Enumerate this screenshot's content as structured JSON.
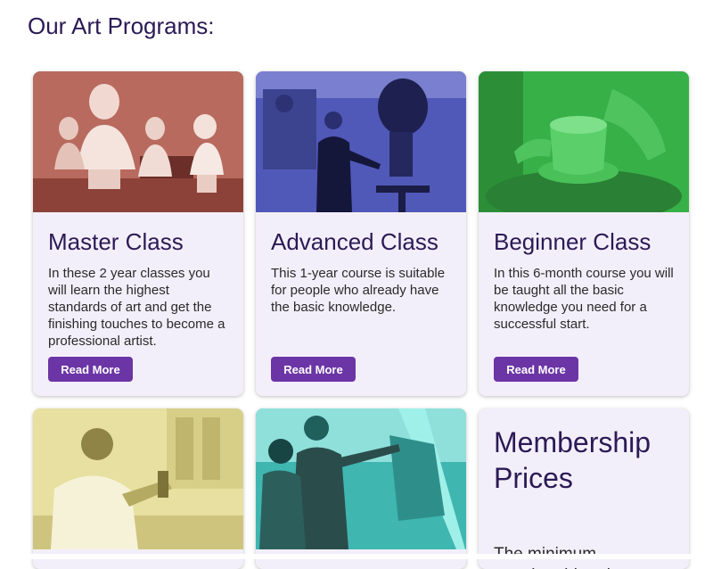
{
  "page": {
    "heading": "Our Art Programs:"
  },
  "cards": [
    {
      "title": "Master Class",
      "text": "In these 2 year classes you will learn the highest standards of art and get the finishing touches to become a professional artist.",
      "button": "Read More"
    },
    {
      "title": "Advanced Class",
      "text": "This 1-year course is suitable for people who already have the basic knowledge.",
      "button": "Read More"
    },
    {
      "title": "Beginner Class",
      "text": "In this 6-month course you will be taught all the basic knowledge you need for a successful start.",
      "button": "Read More"
    }
  ],
  "membership": {
    "title": "Membership Prices",
    "text": "The minimum membership price"
  },
  "colors": {
    "heading": "#2b1a55",
    "card_bg": "#f3effa",
    "button": "#6c35a6",
    "tint_red": "#b86a5e",
    "tint_blue": "#5058b8",
    "tint_green": "#38b048",
    "tint_yellow": "#e7e0a0",
    "tint_teal": "#3fb6b0"
  }
}
